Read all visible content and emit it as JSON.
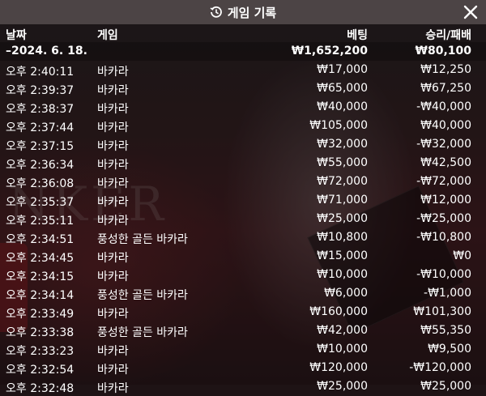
{
  "window": {
    "title": "게임 기록",
    "title_icon": "history-icon",
    "close_icon": "close-icon"
  },
  "columns": {
    "date": "날짜",
    "game": "게임",
    "bet": "베팅",
    "result": "승리/패배"
  },
  "summary": {
    "date": "–2024. 6. 18.",
    "bet": "₩1,652,200",
    "result": "₩80,100"
  },
  "background": {
    "watermark": "NKER"
  },
  "rows": [
    {
      "time": "오후 2:40:11",
      "game": "바카라",
      "bet": "₩17,000",
      "result": "₩12,250"
    },
    {
      "time": "오후 2:39:37",
      "game": "바카라",
      "bet": "₩65,000",
      "result": "₩67,250"
    },
    {
      "time": "오후 2:38:37",
      "game": "바카라",
      "bet": "₩40,000",
      "result": "-₩40,000"
    },
    {
      "time": "오후 2:37:44",
      "game": "바카라",
      "bet": "₩105,000",
      "result": "₩40,000"
    },
    {
      "time": "오후 2:37:15",
      "game": "바카라",
      "bet": "₩32,000",
      "result": "-₩32,000"
    },
    {
      "time": "오후 2:36:34",
      "game": "바카라",
      "bet": "₩55,000",
      "result": "₩42,500"
    },
    {
      "time": "오후 2:36:08",
      "game": "바카라",
      "bet": "₩72,000",
      "result": "-₩72,000"
    },
    {
      "time": "오후 2:35:37",
      "game": "바카라",
      "bet": "₩71,000",
      "result": "₩12,000"
    },
    {
      "time": "오후 2:35:11",
      "game": "바카라",
      "bet": "₩25,000",
      "result": "-₩25,000"
    },
    {
      "time": "오후 2:34:51",
      "game": "풍성한 골든 바카라",
      "bet": "₩10,800",
      "result": "-₩10,800"
    },
    {
      "time": "오후 2:34:45",
      "game": "바카라",
      "bet": "₩15,000",
      "result": "₩0"
    },
    {
      "time": "오후 2:34:15",
      "game": "바카라",
      "bet": "₩10,000",
      "result": "-₩10,000"
    },
    {
      "time": "오후 2:34:14",
      "game": "풍성한 골든 바카라",
      "bet": "₩6,000",
      "result": "-₩1,000"
    },
    {
      "time": "오후 2:33:49",
      "game": "바카라",
      "bet": "₩160,000",
      "result": "₩101,300"
    },
    {
      "time": "오후 2:33:38",
      "game": "풍성한 골든 바카라",
      "bet": "₩42,000",
      "result": "₩55,350"
    },
    {
      "time": "오후 2:33:23",
      "game": "바카라",
      "bet": "₩10,000",
      "result": "₩9,500"
    },
    {
      "time": "오후 2:32:54",
      "game": "바카라",
      "bet": "₩120,000",
      "result": "-₩120,000"
    },
    {
      "time": "오후 2:32:48",
      "game": "바카라",
      "bet": "₩25,000",
      "result": "₩25,000"
    }
  ]
}
